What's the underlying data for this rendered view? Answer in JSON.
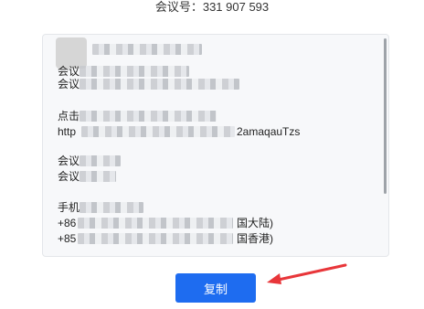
{
  "meeting": {
    "id_text": "会议号：331 907 593"
  },
  "invite": {
    "lines": [
      "会议",
      "会议",
      "点击",
      "http",
      "会议",
      "会议",
      "手机",
      "+86",
      "+85"
    ],
    "link_tail": "2amaqauTzs",
    "region_mainland": "国大陆)",
    "region_hk": "国香港)"
  },
  "actions": {
    "copy_label": "复制"
  },
  "colors": {
    "primary": "#1e6cf0",
    "arrow": "#e8363a",
    "box_bg": "#f7f8fa"
  }
}
